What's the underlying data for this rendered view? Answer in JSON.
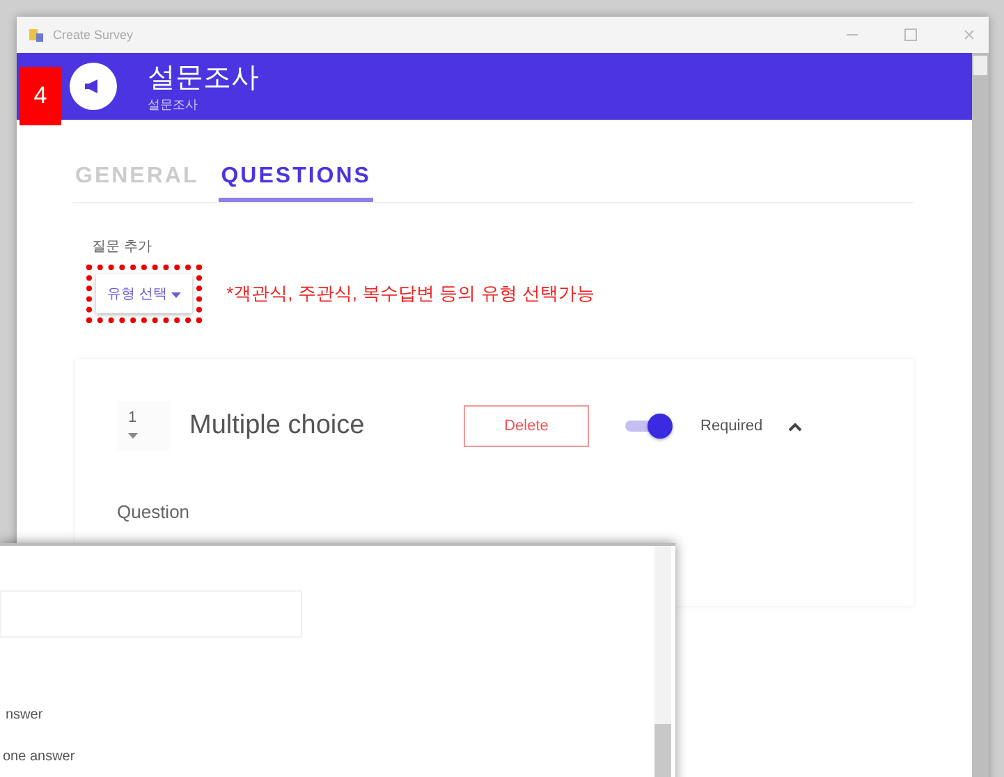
{
  "window": {
    "title": "Create Survey"
  },
  "header": {
    "title": "설문조사",
    "subtitle": "설문조사"
  },
  "step_badge": "4",
  "tabs": [
    {
      "label": "GENERAL",
      "selected": false
    },
    {
      "label": "QUESTIONS",
      "selected": true
    }
  ],
  "add_question": {
    "label": "질문 추가",
    "dropdown": "유형 선택",
    "note": "*객관식, 주관식, 복수답변 등의 유형 선택가능"
  },
  "question": {
    "number": "1",
    "type": "Multiple choice",
    "delete": "Delete",
    "required": {
      "label": "Required",
      "on": true
    },
    "expanded": true,
    "field_label": "Question"
  },
  "overlay_window": {
    "options": [
      "nswer",
      "one answer"
    ]
  }
}
